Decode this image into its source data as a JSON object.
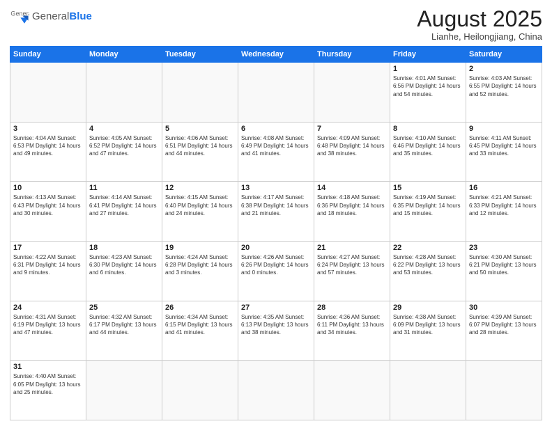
{
  "logo": {
    "text_general": "General",
    "text_blue": "Blue"
  },
  "title": "August 2025",
  "subtitle": "Lianhe, Heilongjiang, China",
  "weekdays": [
    "Sunday",
    "Monday",
    "Tuesday",
    "Wednesday",
    "Thursday",
    "Friday",
    "Saturday"
  ],
  "weeks": [
    [
      {
        "day": "",
        "info": ""
      },
      {
        "day": "",
        "info": ""
      },
      {
        "day": "",
        "info": ""
      },
      {
        "day": "",
        "info": ""
      },
      {
        "day": "",
        "info": ""
      },
      {
        "day": "1",
        "info": "Sunrise: 4:01 AM\nSunset: 6:56 PM\nDaylight: 14 hours and 54 minutes."
      },
      {
        "day": "2",
        "info": "Sunrise: 4:03 AM\nSunset: 6:55 PM\nDaylight: 14 hours and 52 minutes."
      }
    ],
    [
      {
        "day": "3",
        "info": "Sunrise: 4:04 AM\nSunset: 6:53 PM\nDaylight: 14 hours and 49 minutes."
      },
      {
        "day": "4",
        "info": "Sunrise: 4:05 AM\nSunset: 6:52 PM\nDaylight: 14 hours and 47 minutes."
      },
      {
        "day": "5",
        "info": "Sunrise: 4:06 AM\nSunset: 6:51 PM\nDaylight: 14 hours and 44 minutes."
      },
      {
        "day": "6",
        "info": "Sunrise: 4:08 AM\nSunset: 6:49 PM\nDaylight: 14 hours and 41 minutes."
      },
      {
        "day": "7",
        "info": "Sunrise: 4:09 AM\nSunset: 6:48 PM\nDaylight: 14 hours and 38 minutes."
      },
      {
        "day": "8",
        "info": "Sunrise: 4:10 AM\nSunset: 6:46 PM\nDaylight: 14 hours and 35 minutes."
      },
      {
        "day": "9",
        "info": "Sunrise: 4:11 AM\nSunset: 6:45 PM\nDaylight: 14 hours and 33 minutes."
      }
    ],
    [
      {
        "day": "10",
        "info": "Sunrise: 4:13 AM\nSunset: 6:43 PM\nDaylight: 14 hours and 30 minutes."
      },
      {
        "day": "11",
        "info": "Sunrise: 4:14 AM\nSunset: 6:41 PM\nDaylight: 14 hours and 27 minutes."
      },
      {
        "day": "12",
        "info": "Sunrise: 4:15 AM\nSunset: 6:40 PM\nDaylight: 14 hours and 24 minutes."
      },
      {
        "day": "13",
        "info": "Sunrise: 4:17 AM\nSunset: 6:38 PM\nDaylight: 14 hours and 21 minutes."
      },
      {
        "day": "14",
        "info": "Sunrise: 4:18 AM\nSunset: 6:36 PM\nDaylight: 14 hours and 18 minutes."
      },
      {
        "day": "15",
        "info": "Sunrise: 4:19 AM\nSunset: 6:35 PM\nDaylight: 14 hours and 15 minutes."
      },
      {
        "day": "16",
        "info": "Sunrise: 4:21 AM\nSunset: 6:33 PM\nDaylight: 14 hours and 12 minutes."
      }
    ],
    [
      {
        "day": "17",
        "info": "Sunrise: 4:22 AM\nSunset: 6:31 PM\nDaylight: 14 hours and 9 minutes."
      },
      {
        "day": "18",
        "info": "Sunrise: 4:23 AM\nSunset: 6:30 PM\nDaylight: 14 hours and 6 minutes."
      },
      {
        "day": "19",
        "info": "Sunrise: 4:24 AM\nSunset: 6:28 PM\nDaylight: 14 hours and 3 minutes."
      },
      {
        "day": "20",
        "info": "Sunrise: 4:26 AM\nSunset: 6:26 PM\nDaylight: 14 hours and 0 minutes."
      },
      {
        "day": "21",
        "info": "Sunrise: 4:27 AM\nSunset: 6:24 PM\nDaylight: 13 hours and 57 minutes."
      },
      {
        "day": "22",
        "info": "Sunrise: 4:28 AM\nSunset: 6:22 PM\nDaylight: 13 hours and 53 minutes."
      },
      {
        "day": "23",
        "info": "Sunrise: 4:30 AM\nSunset: 6:21 PM\nDaylight: 13 hours and 50 minutes."
      }
    ],
    [
      {
        "day": "24",
        "info": "Sunrise: 4:31 AM\nSunset: 6:19 PM\nDaylight: 13 hours and 47 minutes."
      },
      {
        "day": "25",
        "info": "Sunrise: 4:32 AM\nSunset: 6:17 PM\nDaylight: 13 hours and 44 minutes."
      },
      {
        "day": "26",
        "info": "Sunrise: 4:34 AM\nSunset: 6:15 PM\nDaylight: 13 hours and 41 minutes."
      },
      {
        "day": "27",
        "info": "Sunrise: 4:35 AM\nSunset: 6:13 PM\nDaylight: 13 hours and 38 minutes."
      },
      {
        "day": "28",
        "info": "Sunrise: 4:36 AM\nSunset: 6:11 PM\nDaylight: 13 hours and 34 minutes."
      },
      {
        "day": "29",
        "info": "Sunrise: 4:38 AM\nSunset: 6:09 PM\nDaylight: 13 hours and 31 minutes."
      },
      {
        "day": "30",
        "info": "Sunrise: 4:39 AM\nSunset: 6:07 PM\nDaylight: 13 hours and 28 minutes."
      }
    ],
    [
      {
        "day": "31",
        "info": "Sunrise: 4:40 AM\nSunset: 6:05 PM\nDaylight: 13 hours and 25 minutes."
      },
      {
        "day": "",
        "info": ""
      },
      {
        "day": "",
        "info": ""
      },
      {
        "day": "",
        "info": ""
      },
      {
        "day": "",
        "info": ""
      },
      {
        "day": "",
        "info": ""
      },
      {
        "day": "",
        "info": ""
      }
    ]
  ]
}
